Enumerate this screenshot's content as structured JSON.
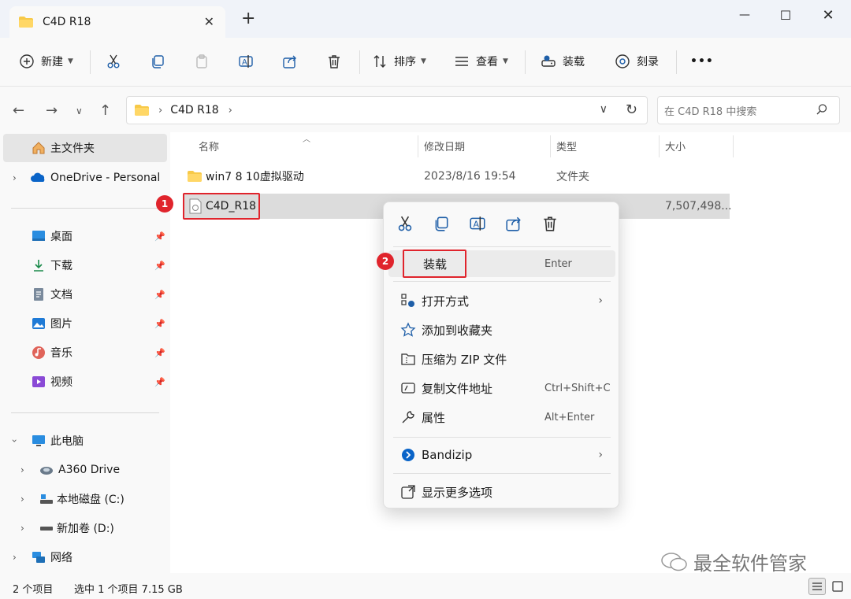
{
  "window": {
    "tab_title": "C4D R18",
    "new_tab": "+",
    "tab_close": "✕",
    "minimize": "—",
    "maximize": "☐",
    "close": "✕"
  },
  "toolbar": {
    "new_label": "新建",
    "sort_label": "排序",
    "view_label": "查看",
    "mount_label": "装载",
    "burn_label": "刻录",
    "more_label": "•••"
  },
  "address": {
    "crumb": "C4D R18",
    "search_placeholder": "在 C4D R18 中搜索"
  },
  "sidebar": {
    "home": "主文件夹",
    "onedrive": "OneDrive - Personal",
    "quick": [
      {
        "label": "桌面",
        "icon": "desktop-icon"
      },
      {
        "label": "下载",
        "icon": "download-icon"
      },
      {
        "label": "文档",
        "icon": "documents-icon"
      },
      {
        "label": "图片",
        "icon": "pictures-icon"
      },
      {
        "label": "音乐",
        "icon": "music-icon"
      },
      {
        "label": "视频",
        "icon": "videos-icon"
      }
    ],
    "this_pc": "此电脑",
    "drives": [
      "A360 Drive",
      "本地磁盘 (C:)",
      "新加卷 (D:)"
    ],
    "network": "网络"
  },
  "columns": {
    "name": "名称",
    "modified": "修改日期",
    "type": "类型",
    "size": "大小"
  },
  "files": [
    {
      "name": "win7 8 10虚拟驱动",
      "modified": "2023/8/16 19:54",
      "type": "文件夹",
      "size": ""
    },
    {
      "name": "C4D_R18",
      "modified": "",
      "type": "",
      "size": "7,507,498..."
    }
  ],
  "badges": {
    "one": "1",
    "two": "2"
  },
  "context_menu": {
    "mount": {
      "label": "装载",
      "shortcut": "Enter"
    },
    "open_with": "打开方式",
    "add_favorites": "添加到收藏夹",
    "compress_zip": "压缩为 ZIP 文件",
    "copy_path": {
      "label": "复制文件地址",
      "shortcut": "Ctrl+Shift+C"
    },
    "properties": {
      "label": "属性",
      "shortcut": "Alt+Enter"
    },
    "bandizip": "Bandizip",
    "more_options": "显示更多选项"
  },
  "status": {
    "item_count": "2 个项目",
    "selection": "选中 1 个项目 7.15 GB"
  },
  "watermark": "最全软件管家",
  "colors": {
    "accent": "#0067c0",
    "highlight_red": "#e0242c",
    "folder": "#f7c948"
  }
}
